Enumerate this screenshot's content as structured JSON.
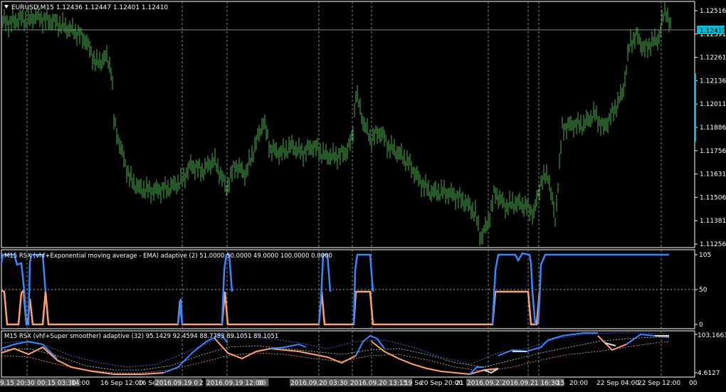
{
  "header": {
    "symbol_text": "EURUSD,M15  1.12436 1.12447 1.12401 1.12410",
    "menu_icon": "triangle-down-icon"
  },
  "main_panel": {
    "price_ticks": [
      "1.12516",
      "1.12391",
      "1.12261",
      "1.12136",
      "1.12011",
      "1.11886",
      "1.11756",
      "1.11631",
      "1.11506",
      "1.11381",
      "1.11256"
    ],
    "current_price": "1.12410"
  },
  "indicator1": {
    "title": "M15 RSX (vhf+Exponential moving average - EMA) adaptive (2) 51.0000 50.0000 49.0000 100.0000 0.0000",
    "ticks": [
      "105",
      "50",
      "0"
    ]
  },
  "indicator2": {
    "title": "M15 RSX (vhf+Super smoother) adaptive (32) 95.1429 92.4594 88.7753 89.1051 89.1051",
    "ticks": [
      "103.1663",
      "4.6127"
    ]
  },
  "time_axis": {
    "labels": [
      "9.15 20:30",
      "00:15 03:30",
      "14:00",
      "16 Sep 12:00",
      "16 Sep",
      "2016.09.19 0",
      "2",
      "2016.09.19 12:00",
      "00",
      "2016.09.20 03:30",
      "2016.09.20 13:15",
      "19 Se",
      "20 Sep 20:00",
      "21",
      "2016.09.21",
      "2016.09.21 16:30",
      "15",
      "20:00",
      "22 Sep 04:00",
      "22 Sep 12:00",
      "00"
    ]
  },
  "colors": {
    "candle": "#4caf50",
    "grid": "#7f8c8d",
    "indicator_up": "#3a86ff",
    "indicator_down": "#ffa270",
    "axis": "#ffffff"
  }
}
